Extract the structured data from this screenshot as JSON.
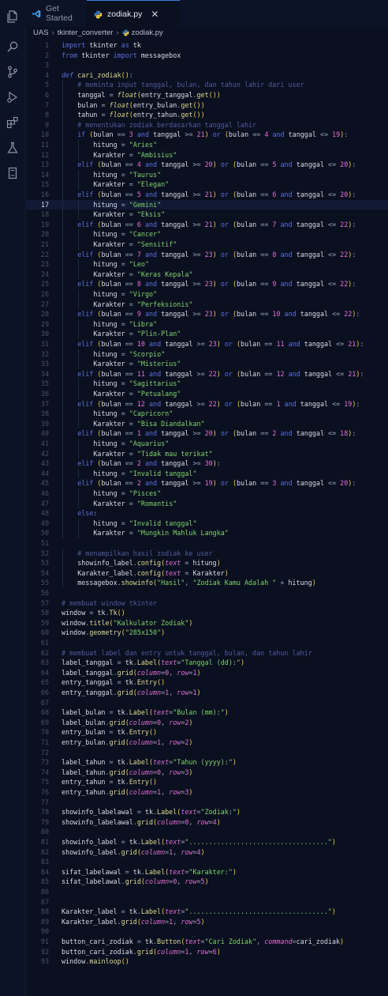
{
  "tabs": [
    {
      "label": "Get Started",
      "icon": "vscode-icon"
    },
    {
      "label": "zodiak.py",
      "icon": "python-icon",
      "close": "✕"
    }
  ],
  "breadcrumb": [
    "UAS",
    "tkinter_converter",
    "zodiak.py"
  ],
  "activity_icons": [
    "files-icon",
    "search-icon",
    "source-control-icon",
    "run-debug-icon",
    "extensions-icon",
    "testing-icon",
    "remote-explorer-icon"
  ],
  "current_line": 17,
  "colors": {
    "keyword": "#5b6ee1",
    "string": "#7fd36a",
    "number": "#e66fd6",
    "comment": "#4f5a9e",
    "param": "#e06dd1",
    "function": "#dcdc8b",
    "accent": "#3a80d9"
  },
  "code_lines": [
    "import tkinter as tk",
    "from tkinter import messagebox",
    "",
    "def cari_zodiak():",
    "    # meminta input tanggal, bulan, dan tahun lahir dari user",
    "    tanggal = float(entry_tanggal.get())",
    "    bulan = float(entry_bulan.get())",
    "    tahun = float(entry_tahun.get())",
    "    # menentukan zodiak berdasarkan tanggal lahir",
    "    if (bulan == 3 and tanggal >= 21) or (bulan == 4 and tanggal <= 19):",
    "        hitung = \"Aries\"",
    "        Karakter = \"Ambisius\"",
    "    elif (bulan == 4 and tanggal >= 20) or (bulan == 5 and tanggal <= 20):",
    "        hitung = \"Taurus\"",
    "        Karakter = \"Elegan\"",
    "    elif (bulan == 5 and tanggal >= 21) or (bulan == 6 and tanggal <= 20):",
    "        hitung = \"Gemini\"",
    "        Karakter = \"Eksis\"",
    "    elif (bulan == 6 and tanggal >= 21) or (bulan == 7 and tanggal <= 22):",
    "        hitung = \"Cancer\"",
    "        Karakter = \"Sensitif\"",
    "    elif (bulan == 7 and tanggal >= 23) or (bulan == 8 and tanggal <= 22):",
    "        hitung = \"Leo\"",
    "        Karakter = \"Keras Kepala\"",
    "    elif (bulan == 8 and tanggal >= 23) or (bulan == 9 and tanggal <= 22):",
    "        hitung = \"Virgo\"",
    "        Karakter = \"Perfeksionis\"",
    "    elif (bulan == 9 and tanggal >= 23) or (bulan == 10 and tanggal <= 22):",
    "        hitung = \"Libra\"",
    "        Karakter = \"Plin-Plan\"",
    "    elif (bulan == 10 and tanggal >= 23) or (bulan == 11 and tanggal <= 21):",
    "        hitung = \"Scorpio\"",
    "        Karakter = \"Misterius\"",
    "    elif (bulan == 11 and tanggal >= 22) or (bulan == 12 and tanggal <= 21):",
    "        hitung = \"Sagittarius\"",
    "        Karakter = \"Petualang\"",
    "    elif (bulan == 12 and tanggal >= 22) or (bulan == 1 and tanggal <= 19):",
    "        hitung = \"Capricorn\"",
    "        Karakter = \"Bisa Diandalkan\"",
    "    elif (bulan == 1 and tanggal >= 20) or (bulan == 2 and tanggal <= 18):",
    "        hitung = \"Aquarius\"",
    "        Karakter = \"Tidak mau terikat\"",
    "    elif (bulan == 2 and tanggal >= 30):",
    "        hitung = \"Invalid tanggal\"",
    "    elif (bulan == 2 and tanggal >= 19) or (bulan == 3 and tanggal <= 20):",
    "        hitung = \"Pisces\"",
    "        Karakter = \"Romantis\"",
    "    else:",
    "        hitung = \"Invalid tanggal\"",
    "        Karakter = \"Mungkin Mahluk Langka\"",
    "",
    "    # menampilkan hasil zodiak ke user",
    "    showinfo_label.config(text = hitung)",
    "    Karakter_label.config(text = Karakter)",
    "    messagebox.showinfo(\"Hasil\", \"Zodiak Kamu Adalah \" + hitung)",
    "",
    "# membuat window tkinter",
    "window = tk.Tk()",
    "window.title(\"Kalkulator Zodiak\")",
    "window.geometry(\"285x150\")",
    "",
    "# membuat label dan entry untuk tanggal, bulan, dan tahun lahir",
    "label_tanggal = tk.Label(text=\"Tanggal (dd):\")",
    "label_tanggal.grid(column=0, row=1)",
    "entry_tanggal = tk.Entry()",
    "entry_tanggal.grid(column=1, row=1)",
    "",
    "label_bulan = tk.Label(text=\"Bulan (mm):\")",
    "label_bulan.grid(column=0, row=2)",
    "entry_bulan = tk.Entry()",
    "entry_bulan.grid(column=1, row=2)",
    "",
    "label_tahun = tk.Label(text=\"Tahun (yyyy):\")",
    "label_tahun.grid(column=0, row=3)",
    "entry_tahun = tk.Entry()",
    "entry_tahun.grid(column=1, row=3)",
    "",
    "showinfo_labelawal = tk.Label(text=\"Zodiak:\")",
    "showinfo_labelawal.grid(column=0, row=4)",
    "",
    "showinfo_label = tk.Label(text=\"...................................\")",
    "showinfo_label.grid(column=1, row=4)",
    "",
    "sifat_labelawal = tk.Label(text=\"Karakter:\")",
    "sifat_labelawal.grid(column=0, row=5)",
    "",
    "",
    "Karakter_label = tk.Label(text=\"...................................\")",
    "Karakter_label.grid(column=1, row=5)",
    "",
    "button_cari_zodiak = tk.Button(text=\"Cari Zodiak\", command=cari_zodiak)",
    "button_cari_zodiak.grid(column=1, row=6)",
    "window.mainloop()"
  ]
}
